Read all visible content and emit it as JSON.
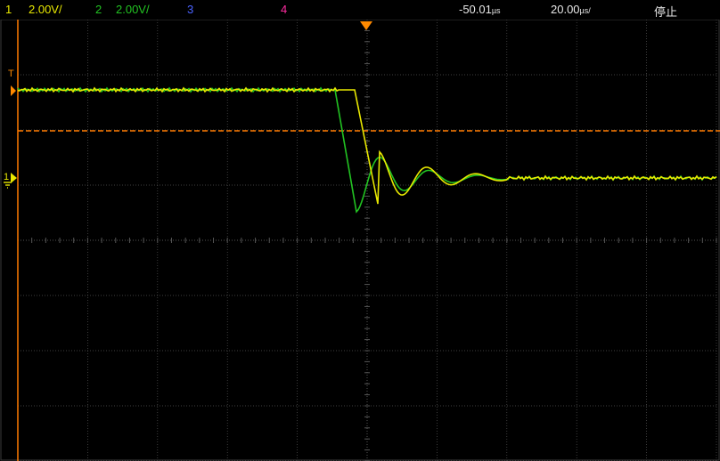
{
  "status_bar": {
    "ch1": {
      "number": "1",
      "scale": "2.00V/",
      "color": "#e8e800"
    },
    "ch2": {
      "number": "2",
      "scale": "2.00V/",
      "color": "#22c322"
    },
    "ch3": {
      "number": "3",
      "color": "#4a62ff"
    },
    "ch4": {
      "number": "4",
      "color": "#ff2ca0"
    },
    "time_offset": {
      "value": "-50.01",
      "unit_glyph": "µs"
    },
    "time_scale": {
      "value": "20.00",
      "unit_glyph": "µs/"
    },
    "run_state": "停止"
  },
  "markers": {
    "trigger_label": "T",
    "ground_label": "1",
    "trigger_color": "#ff8a00",
    "trigger_level_color": "#ff7a00"
  },
  "screen": {
    "grid": true,
    "h_divisions": 10,
    "v_divisions": 8,
    "grid_color": "#555555",
    "trace_colors": {
      "ch1": "#e8e800",
      "ch2": "#22c322"
    }
  }
}
